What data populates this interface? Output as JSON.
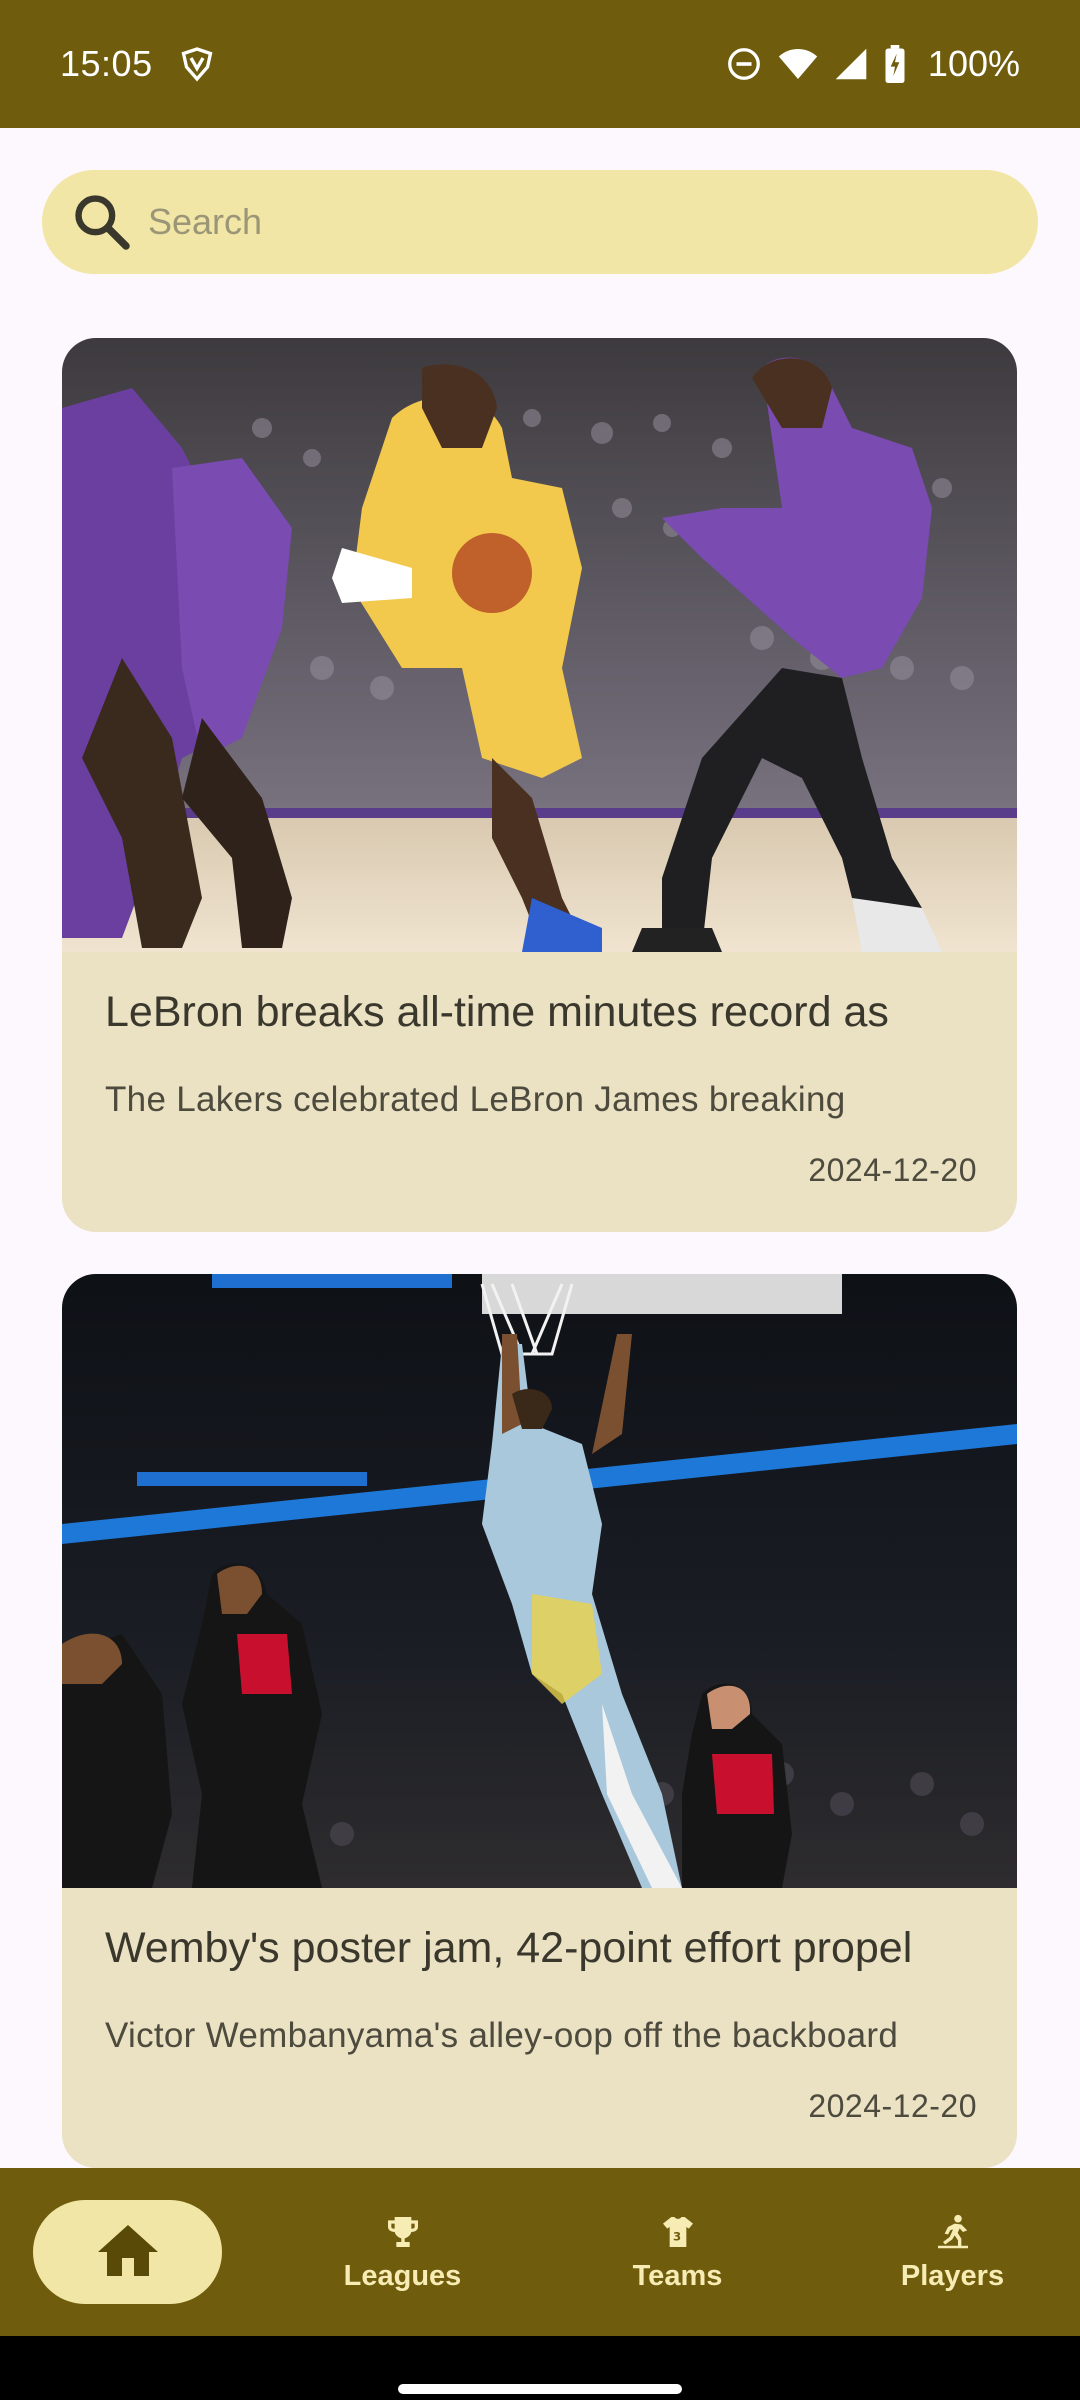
{
  "status_bar": {
    "time": "15:05",
    "battery": "100%",
    "icons": [
      "vpn-icon",
      "dnd-icon",
      "wifi-icon",
      "signal-icon",
      "battery-charging-icon"
    ]
  },
  "search": {
    "placeholder": "Search"
  },
  "articles": [
    {
      "title": "LeBron breaks all-time minutes record as",
      "description": "The Lakers celebrated LeBron James breaking",
      "date": "2024-12-20",
      "image": "basketball-game-photo-lakers-kings"
    },
    {
      "title": "Wemby's poster jam, 42-point effort propel",
      "description": "Victor Wembanyama's alley-oop off the backboard",
      "date": "2024-12-20",
      "image": "basketball-game-photo-spurs-hawks"
    }
  ],
  "bottom_nav": {
    "home_icon": "home-icon",
    "items": [
      {
        "label": "Leagues",
        "icon": "trophy-icon"
      },
      {
        "label": "Teams",
        "icon": "jersey-icon"
      },
      {
        "label": "Players",
        "icon": "player-icon"
      }
    ],
    "selected": "home"
  },
  "colors": {
    "primary": "#6f5d0d",
    "container": "#f1e6a5",
    "card": "#ebe1c3",
    "background": "#fdf8fd"
  }
}
